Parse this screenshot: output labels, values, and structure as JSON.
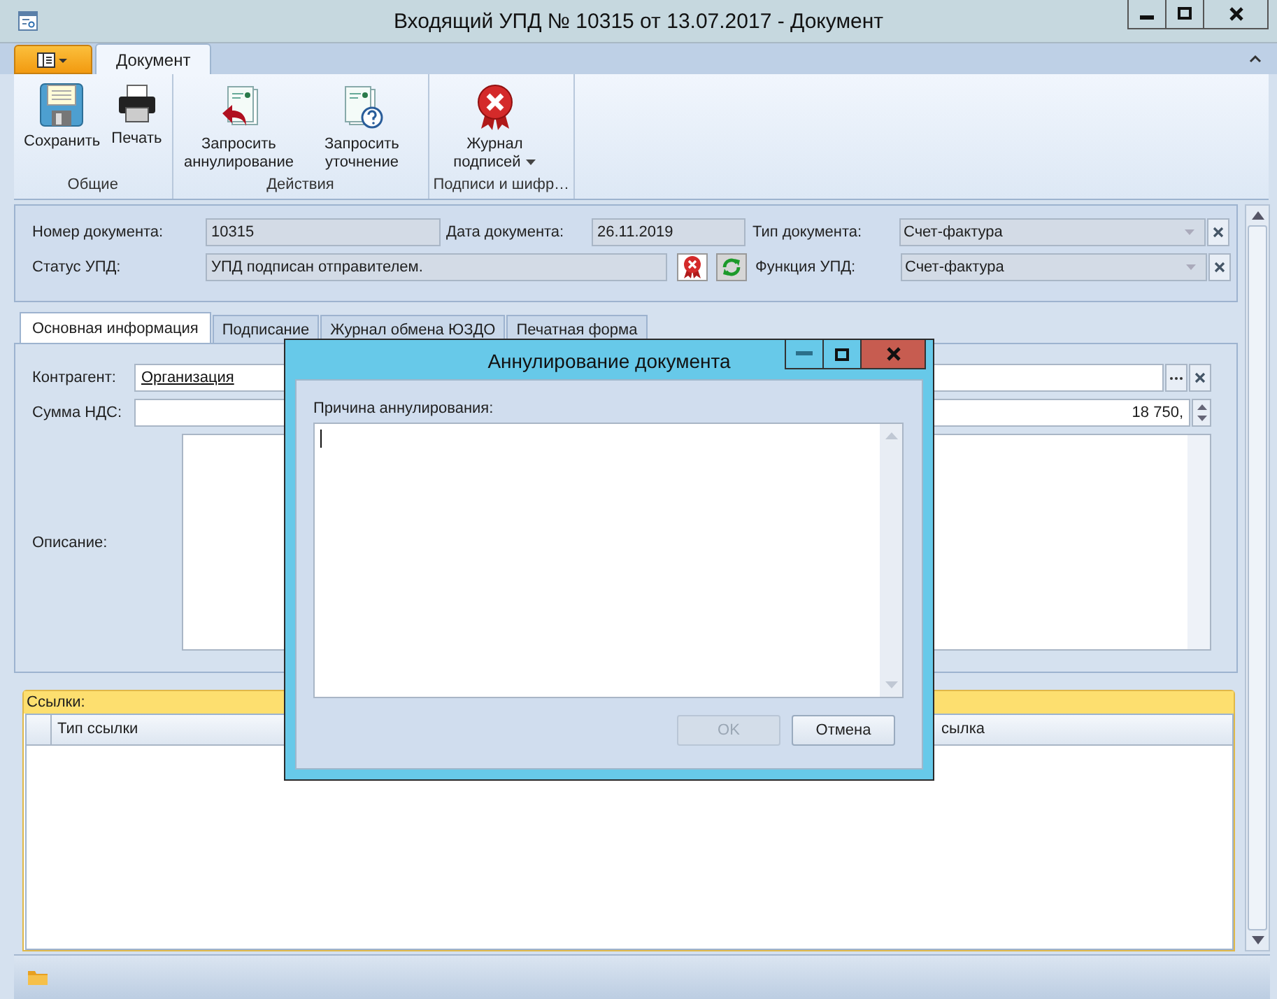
{
  "window": {
    "title": "Входящий УПД № 10315 от 13.07.2017 - Документ"
  },
  "ribbon": {
    "tabs": [
      {
        "label": "Документ",
        "selected": true
      }
    ],
    "groups": [
      {
        "label": "Общие",
        "buttons": [
          {
            "label": "Сохранить",
            "kind": "save"
          },
          {
            "label": "Печать",
            "kind": "print"
          }
        ]
      },
      {
        "label": "Действия",
        "buttons": [
          {
            "label": "Запросить аннулирование",
            "kind": "revoke"
          },
          {
            "label": "Запросить уточнение",
            "kind": "clarify"
          }
        ]
      },
      {
        "label": "Подписи и шифр…",
        "buttons": [
          {
            "label": "Журнал подписей",
            "kind": "journal",
            "dropdown": true
          }
        ]
      }
    ]
  },
  "header": {
    "number": {
      "label": "Номер документа:",
      "value": "10315"
    },
    "date": {
      "label": "Дата документа:",
      "value": "26.11.2019"
    },
    "doc_type": {
      "label": "Тип документа:",
      "value": "Счет-фактура"
    },
    "status": {
      "label": "Статус УПД:",
      "value": "УПД подписан отправителем."
    },
    "function": {
      "label": "Функция УПД:",
      "value": "Счет-фактура"
    }
  },
  "tabs": [
    {
      "label": "Основная информация",
      "selected": true
    },
    {
      "label": "Подписание",
      "selected": false
    },
    {
      "label": "Журнал обмена ЮЗДО",
      "selected": false
    },
    {
      "label": "Печатная форма",
      "selected": false
    }
  ],
  "main": {
    "counterparty": {
      "label": "Контрагент:",
      "value": "Организация"
    },
    "vat": {
      "label": "Сумма НДС:",
      "value": "18 750,"
    },
    "description": {
      "label": "Описание:"
    }
  },
  "links": {
    "title": "Ссылки:",
    "columns": [
      "Тип ссылки",
      "сылка"
    ]
  },
  "dialog": {
    "title": "Аннулирование документа",
    "field_label": "Причина аннулирования:",
    "buttons": [
      {
        "label": "OK",
        "disabled": true
      },
      {
        "label": "Отмена",
        "disabled": false
      }
    ]
  }
}
